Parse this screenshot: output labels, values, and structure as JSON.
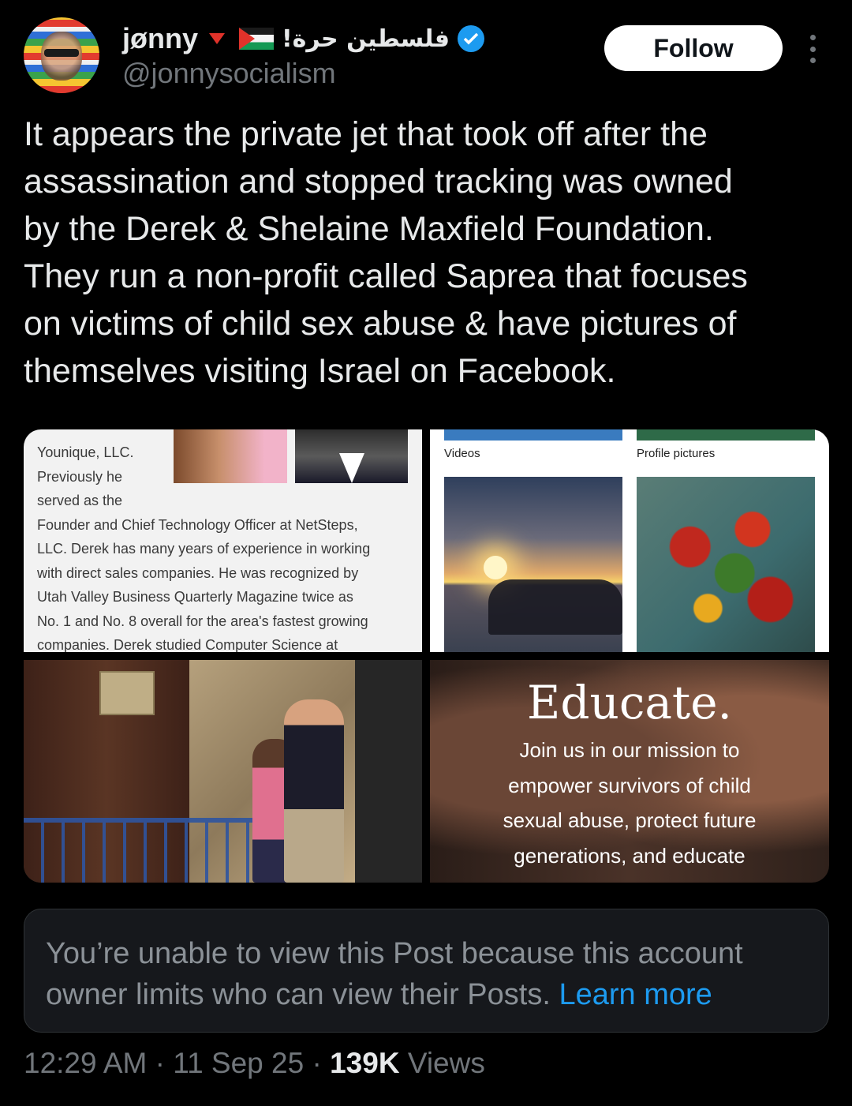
{
  "author": {
    "display_name": "jønny",
    "arabic_text": "فلسطين حرة!",
    "handle": "@jonnysocialism",
    "icons": [
      "red-triangle-icon",
      "palestine-flag-icon",
      "verified-badge-icon"
    ]
  },
  "follow_label": "Follow",
  "tweet_lines": [
    "It appears the private jet that took off after the",
    "assassination and stopped tracking was owned",
    "by the Derek & Shelaine Maxfield Foundation.",
    "They run a non-profit called Saprea that focuses",
    "on victims of child sex abuse & have pictures of",
    "themselves visiting Israel on Facebook."
  ],
  "media": {
    "bio": {
      "lines": [
        "Younique, LLC.",
        "Previously he",
        "served as the",
        "Founder and Chief Technology Officer at NetSteps,",
        "LLC. Derek has many years of experience in working",
        "with direct sales companies. He was recognized by",
        "Utah Valley Business Quarterly Magazine twice as",
        "No. 1 and No. 8 overall for the area's fastest growing",
        "companies. Derek studied Computer Science at"
      ]
    },
    "facebook": {
      "videos_label": "Videos",
      "profile_pictures_label": "Profile pictures"
    },
    "saprea": {
      "heading": "Educate.",
      "lines": [
        "Join us in our mission to",
        "empower survivors of child",
        "sexual abuse, protect future",
        "generations, and educate"
      ]
    }
  },
  "notice": {
    "text": "You’re unable to view this Post because this account owner limits who can view their Posts.",
    "link": "Learn more"
  },
  "meta": {
    "time": "12:29 AM",
    "date": "11 Sep 25",
    "views_count": "139K",
    "views_label": "Views"
  },
  "colors": {
    "background": "#000000",
    "accent": "#1d9bf0",
    "secondary_text": "#71767b"
  }
}
